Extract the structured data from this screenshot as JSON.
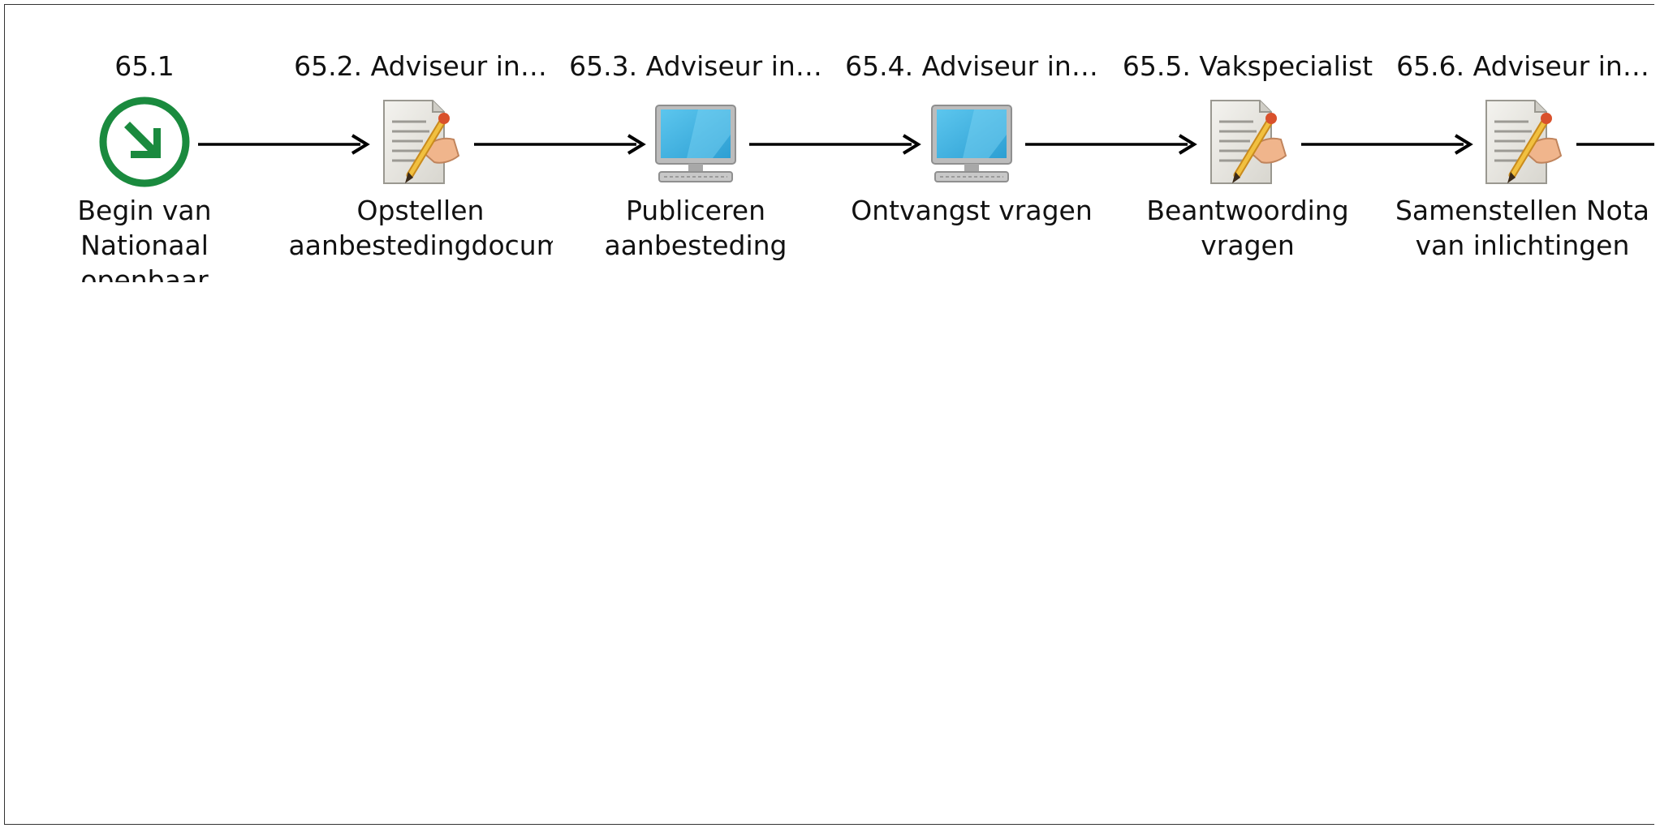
{
  "colors": {
    "start_green": "#1a8a3e",
    "monitor_blue": "#3bb2e3",
    "paper": "#ecebe6",
    "arrow": "#000000"
  },
  "nodes": [
    {
      "header": "65.1",
      "label": "Begin van Nationaal openbaar",
      "icon": "start-arrow-icon"
    },
    {
      "header": "65.2. Adviseur in…",
      "label": "Opstellen aanbestedingdocum",
      "icon": "document-edit-icon"
    },
    {
      "header": "65.3. Adviseur in…",
      "label": "Publiceren aanbesteding",
      "icon": "computer-monitor-icon"
    },
    {
      "header": "65.4. Adviseur in…",
      "label": "Ontvangst vragen",
      "icon": "computer-monitor-icon"
    },
    {
      "header": "65.5. Vakspecialist",
      "label": "Beantwoording vragen",
      "icon": "document-edit-icon"
    },
    {
      "header": "65.6. Adviseur in…",
      "label": "Samenstellen Nota van inlichtingen",
      "icon": "document-edit-icon"
    }
  ]
}
